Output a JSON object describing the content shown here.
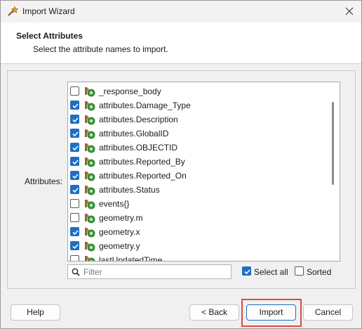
{
  "window": {
    "title": "Import Wizard",
    "icons": {
      "app": "wizard-wand-icon",
      "close": "close-icon"
    }
  },
  "header": {
    "title": "Select Attributes",
    "subtitle": "Select the attribute names to import."
  },
  "attributes": {
    "label": "Attributes:",
    "items": [
      {
        "name": "_response_body",
        "checked": false
      },
      {
        "name": "attributes.Damage_Type",
        "checked": true
      },
      {
        "name": "attributes.Description",
        "checked": true
      },
      {
        "name": "attributes.GlobalID",
        "checked": true
      },
      {
        "name": "attributes.OBJECTID",
        "checked": true
      },
      {
        "name": "attributes.Reported_By",
        "checked": true
      },
      {
        "name": "attributes.Reported_On",
        "checked": true
      },
      {
        "name": "attributes.Status",
        "checked": true
      },
      {
        "name": "events{}",
        "checked": false
      },
      {
        "name": "geometry.m",
        "checked": false
      },
      {
        "name": "geometry.x",
        "checked": true
      },
      {
        "name": "geometry.y",
        "checked": true
      },
      {
        "name": "lastUpdatedTime",
        "checked": false
      }
    ],
    "row_icon": "attribute-field-icon"
  },
  "filter": {
    "placeholder": "Filter",
    "value": ""
  },
  "select_all": {
    "label": "Select all",
    "checked": true
  },
  "sorted": {
    "label": "Sorted",
    "checked": false
  },
  "buttons": {
    "help": "Help",
    "back": "< Back",
    "import": "Import",
    "cancel": "Cancel"
  },
  "colors": {
    "accent": "#1f6ec2",
    "highlight": "#e04848"
  }
}
